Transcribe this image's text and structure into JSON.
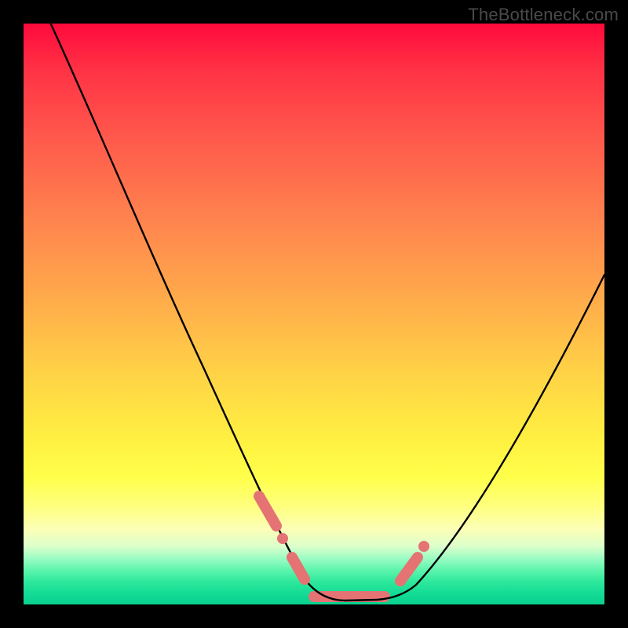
{
  "watermark": "TheBottleneck.com",
  "colors": {
    "frame_background": "#000000",
    "curve_stroke": "#000000",
    "marker_color": "#e57373",
    "gradient_stops": [
      "#ff0a3c",
      "#ff3245",
      "#ff5a4c",
      "#ff874e",
      "#ffad4a",
      "#ffd246",
      "#fff141",
      "#ffff4a",
      "#ffff7d",
      "#fcffb6",
      "#dcffcb",
      "#9dfcc4",
      "#60f5ae",
      "#2fe99c",
      "#15dc96",
      "#08d08e"
    ]
  },
  "chart_data": {
    "type": "line",
    "title": "",
    "xlabel": "",
    "ylabel": "",
    "xlim": [
      0,
      100
    ],
    "ylim": [
      0,
      100
    ],
    "grid": false,
    "series": [
      {
        "name": "bottleneck-curve",
        "x": [
          4,
          10,
          15,
          20,
          25,
          30,
          35,
          40,
          45,
          48,
          50,
          52,
          55,
          58,
          60,
          63,
          68,
          73,
          78,
          83,
          88,
          93,
          98,
          100
        ],
        "y": [
          100,
          88,
          78,
          69,
          59,
          50,
          41,
          32,
          22,
          15,
          10,
          6,
          2,
          0,
          0,
          0,
          3,
          8,
          15,
          23,
          32,
          42,
          52,
          57
        ]
      }
    ],
    "annotations": [
      {
        "kind": "marker-segment",
        "x": [
          40,
          43
        ],
        "y": [
          17,
          12
        ],
        "note": "segment on left descending branch"
      },
      {
        "kind": "marker-dot",
        "x": 44,
        "y": 10,
        "note": "dot on left descending branch"
      },
      {
        "kind": "marker-segment",
        "x": [
          46,
          48
        ],
        "y": [
          6,
          3
        ],
        "note": "short segment near left of valley"
      },
      {
        "kind": "marker-segment",
        "x": [
          50,
          62
        ],
        "y": [
          1,
          1
        ],
        "note": "flat valley segment"
      },
      {
        "kind": "marker-segment",
        "x": [
          65,
          68
        ],
        "y": [
          4,
          8
        ],
        "note": "segment on right ascending branch"
      },
      {
        "kind": "marker-dot",
        "x": 69,
        "y": 10,
        "note": "dot on right ascending branch"
      }
    ],
    "legend_position": "none"
  }
}
